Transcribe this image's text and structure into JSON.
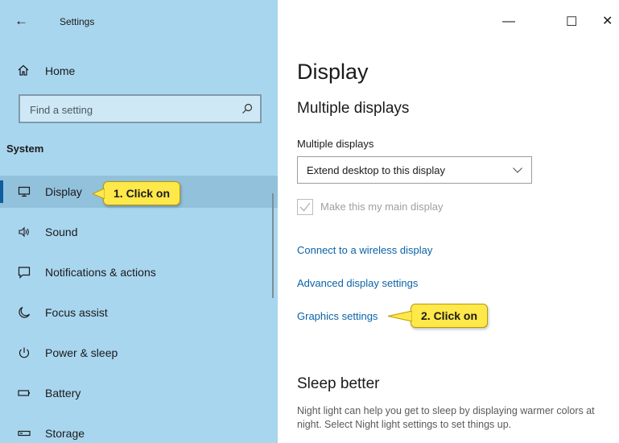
{
  "window": {
    "title": "Settings",
    "back_icon": "back-arrow-icon",
    "controls": [
      "minimize",
      "maximize",
      "close"
    ]
  },
  "sidebar": {
    "home_label": "Home",
    "search_placeholder": "Find a setting",
    "section_title": "System",
    "selected": "Display",
    "items": [
      {
        "label": "Display",
        "icon": "monitor-icon"
      },
      {
        "label": "Sound",
        "icon": "speaker-icon"
      },
      {
        "label": "Notifications & actions",
        "icon": "notification-icon"
      },
      {
        "label": "Focus assist",
        "icon": "moon-icon"
      },
      {
        "label": "Power & sleep",
        "icon": "power-icon"
      },
      {
        "label": "Battery",
        "icon": "battery-icon"
      },
      {
        "label": "Storage",
        "icon": "storage-icon"
      }
    ]
  },
  "main": {
    "page_title": "Display",
    "multiple_displays_heading": "Multiple displays",
    "multiple_displays_label": "Multiple displays",
    "dropdown_value": "Extend desktop to this display",
    "checkbox_label": "Make this my main display",
    "checkbox_checked": true,
    "checkbox_enabled": false,
    "links": [
      "Connect to a wireless display",
      "Advanced display settings",
      "Graphics settings"
    ],
    "sleep_heading": "Sleep better",
    "sleep_text": "Night light can help you get to sleep by displaying warmer colors at night. Select Night light settings to set things up."
  },
  "annotations": {
    "callout1": "1. Click on",
    "callout2": "2. Click on"
  },
  "colors": {
    "sidebar_bg": "#a9d6ef",
    "selected_bg": "#92c1dc",
    "accent": "#0e5d9e",
    "link": "#0a63a8",
    "callout": "#ffe84a"
  }
}
